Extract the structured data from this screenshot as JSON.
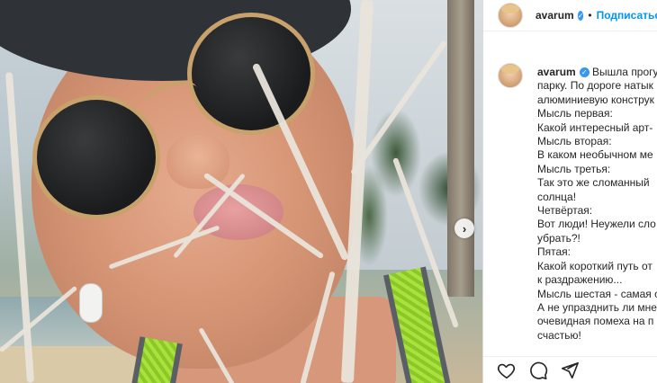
{
  "post": {
    "username": "avarum",
    "follow_label": "Подписаться",
    "separator": "•",
    "verified_mark": "✓"
  },
  "caption": {
    "username": "avarum",
    "lines": [
      "Вышла прогу",
      "парку. По дороге натык",
      "алюминиевую конструк",
      "Мысль первая:",
      "Какой интересный арт-",
      "Мысль вторая:",
      "В каком необычном ме",
      "Мысль третья:",
      "Так это же сломанный ",
      "солнца!",
      "Четвёртая:",
      "Вот люди! Неужели сло",
      "убрать?!",
      "Пятая:",
      "Какой короткий путь от",
      "к раздражению...",
      "Мысль шестая - самая с",
      "А не упразднить ли мне",
      "очевидная помеха на п",
      "счастью!"
    ]
  },
  "icons": {
    "like": "heart-icon",
    "comment": "comment-icon",
    "share": "share-icon",
    "next": "chevron-right-icon"
  },
  "colors": {
    "accent": "#0095f6",
    "verified": "#3897f0",
    "text": "#262626"
  }
}
